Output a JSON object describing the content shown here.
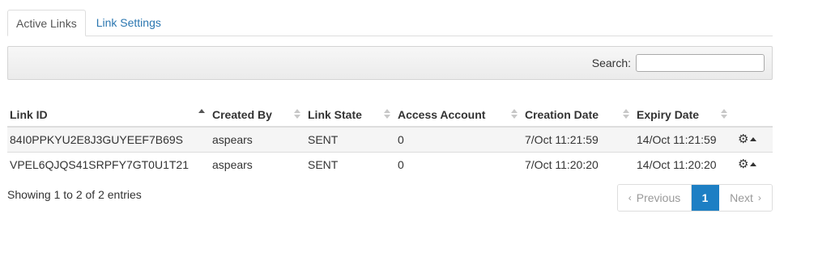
{
  "tabs": [
    {
      "label": "Active Links"
    },
    {
      "label": "Link Settings"
    }
  ],
  "search": {
    "label": "Search:",
    "value": "",
    "placeholder": ""
  },
  "table": {
    "columns": [
      {
        "label": "Link ID",
        "sort": "asc"
      },
      {
        "label": "Created By",
        "sort": "both"
      },
      {
        "label": "Link State",
        "sort": "both"
      },
      {
        "label": "Access Account",
        "sort": "both"
      },
      {
        "label": "Creation Date",
        "sort": "both"
      },
      {
        "label": "Expiry Date",
        "sort": "both"
      }
    ],
    "rows": [
      {
        "link_id": "84I0PPKYU2E8J3GUYEEF7B69S",
        "created_by": "aspears",
        "link_state": "SENT",
        "access_account": "0",
        "creation_date": "7/Oct 11:21:59",
        "expiry_date": "14/Oct 11:21:59"
      },
      {
        "link_id": "VPEL6QJQS41SRPFY7GT0U1T21",
        "created_by": "aspears",
        "link_state": "SENT",
        "access_account": "0",
        "creation_date": "7/Oct 11:20:20",
        "expiry_date": "14/Oct 11:20:20"
      }
    ]
  },
  "footer": {
    "info": "Showing 1 to 2 of 2 entries"
  },
  "pager": {
    "previous": "Previous",
    "current": "1",
    "next": "Next"
  },
  "icons": {
    "row_actions": "gear-icon",
    "menu_toggle": "caret-up-icon",
    "sort": "sort-icon"
  },
  "colors": {
    "accent": "#1d7fc4",
    "link": "#2a76b0"
  }
}
